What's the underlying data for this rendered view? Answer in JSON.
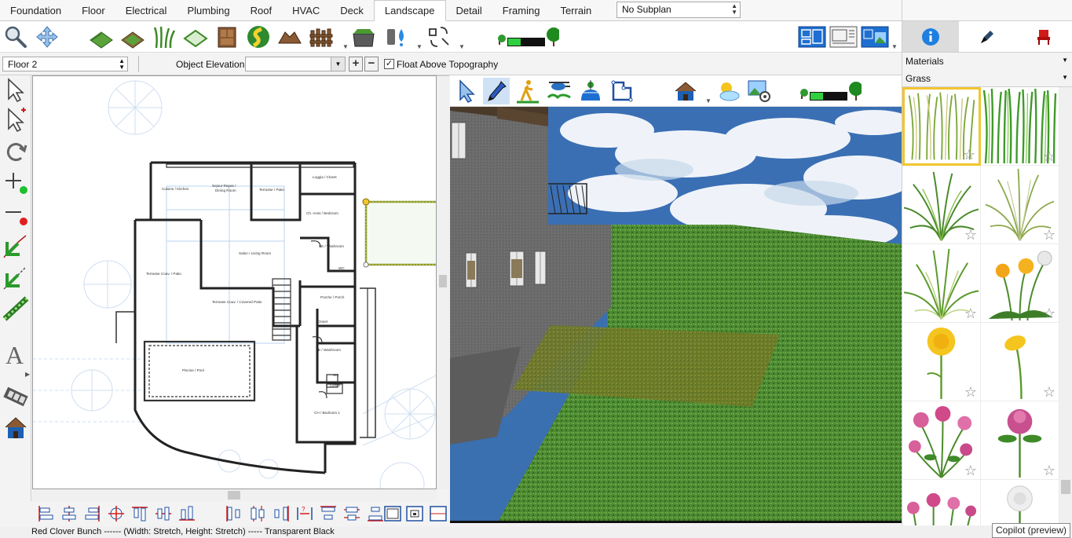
{
  "tabs": [
    "Foundation",
    "Floor",
    "Electrical",
    "Plumbing",
    "Roof",
    "HVAC",
    "Deck",
    "Landscape",
    "Detail",
    "Framing",
    "Terrain"
  ],
  "active_tab": "Landscape",
  "subplan": {
    "value": "No Subplan"
  },
  "floor": {
    "value": "Floor 2"
  },
  "object_elevation": {
    "label": "Object Elevation:",
    "value": ""
  },
  "float_topography": {
    "label": "Float Above Topography",
    "checked": true,
    "check_glyph": "✓"
  },
  "elevation_buttons": {
    "plus": "+",
    "minus": "−"
  },
  "right_tabs": [
    {
      "icon": "info-icon",
      "selected": true
    },
    {
      "icon": "pen-icon",
      "selected": false
    },
    {
      "icon": "chair-icon",
      "selected": false
    }
  ],
  "materials": {
    "category": "Materials",
    "subcategory": "Grass",
    "items": [
      {
        "icon": "tall-grass-icon",
        "selected": true
      },
      {
        "icon": "dense-grass-icon",
        "selected": false
      },
      {
        "icon": "ornamental-grass-icon",
        "selected": false
      },
      {
        "icon": "feather-grass-icon",
        "selected": false
      },
      {
        "icon": "fountain-grass-icon",
        "selected": false
      },
      {
        "icon": "dandelion-plant-icon",
        "selected": false
      },
      {
        "icon": "dandelion-flower-icon",
        "selected": false
      },
      {
        "icon": "dandelion-single-icon",
        "selected": false
      },
      {
        "icon": "red-clover-bunch-icon",
        "selected": false
      },
      {
        "icon": "red-clover-icon",
        "selected": false
      },
      {
        "icon": "clover-field-icon",
        "selected": false
      },
      {
        "icon": "white-clover-icon",
        "selected": false
      }
    ],
    "star_glyph": "☆"
  },
  "rooms": [
    "Cuisine / Kitchen",
    "Sejour Repas /",
    "Dining Room",
    "Terrasse / Patio",
    "Loggia / Closet",
    "Ch. Amis / Bedroom",
    "SE / Washroom",
    "Salon / Living Room",
    "Terrasse Couv. / Patio",
    "WC",
    "Porche / Porch",
    "Terrasse Couv. / Covered Patio",
    "Closet",
    "SE / Washroom",
    "WC",
    "Closet",
    "Piscine / Pool",
    "CH / Bedroom 1"
  ],
  "status": {
    "text": "Red Clover Bunch ------  (Width: Stretch, Height: Stretch) ----- Transparent Black",
    "copilot": "Copilot (preview)"
  },
  "colors": {
    "accent_blue": "#1e6fd1",
    "grass": "#4d8a32",
    "selection": "#f2c531",
    "info_blue": "#1e7fe0"
  }
}
